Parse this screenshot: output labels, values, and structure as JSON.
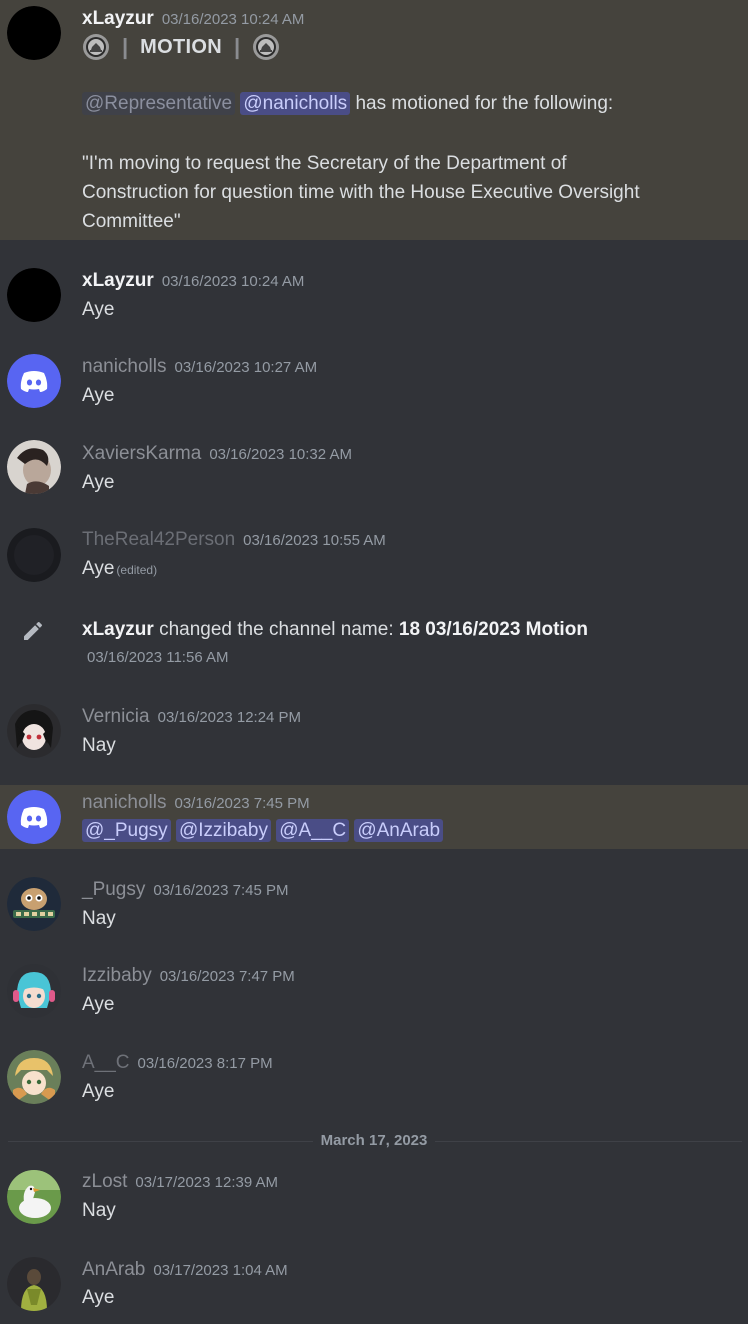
{
  "messages": [
    {
      "username": "xLayzur",
      "timestamp": "03/16/2023 10:24 AM",
      "motion_title": "MOTION",
      "mentions": [
        "@Representative",
        "@nanicholls"
      ],
      "motion_intro": "has motioned for the following:",
      "quote_lines": [
        "\"I'm moving to request the Secretary of the Department of",
        "Construction for question time with the House Executive Oversight",
        "Committee\""
      ]
    },
    {
      "username": "xLayzur",
      "timestamp": "03/16/2023 10:24 AM",
      "content": "Aye"
    },
    {
      "username": "nanicholls",
      "timestamp": "03/16/2023 10:27 AM",
      "content": "Aye"
    },
    {
      "username": "XaviersKarma",
      "timestamp": "03/16/2023 10:32 AM",
      "content": "Aye"
    },
    {
      "username": "TheReal42Person",
      "timestamp": "03/16/2023 10:55 AM",
      "content": "Aye",
      "edited": "(edited)"
    },
    {
      "system": true,
      "actor": "xLayzur",
      "action": "changed the channel name:",
      "new_name": "18 03/16/2023 Motion",
      "timestamp": "03/16/2023 11:56 AM"
    },
    {
      "username": "Vernicia",
      "timestamp": "03/16/2023 12:24 PM",
      "content": "Nay"
    },
    {
      "username": "nanicholls",
      "timestamp": "03/16/2023 7:45 PM",
      "mentions": [
        "@_Pugsy",
        "@Izzibaby",
        "@A__C",
        "@AnArab"
      ]
    },
    {
      "username": "_Pugsy",
      "timestamp": "03/16/2023 7:45 PM",
      "content": "Nay"
    },
    {
      "username": "Izzibaby",
      "timestamp": "03/16/2023 7:47 PM",
      "content": "Aye"
    },
    {
      "username": "A__C",
      "timestamp": "03/16/2023 8:17 PM",
      "content": "Aye"
    },
    {
      "username": "zLost",
      "timestamp": "03/17/2023 12:39 AM",
      "content": "Nay"
    },
    {
      "username": "AnArab",
      "timestamp": "03/17/2023 1:04 AM",
      "content": "Aye"
    }
  ],
  "date_divider": "March 17, 2023",
  "colors": {
    "background": "#313338",
    "highlight": "#45433d",
    "mention_bg": "#4a4d86",
    "discord_blurple": "#5865f2"
  }
}
